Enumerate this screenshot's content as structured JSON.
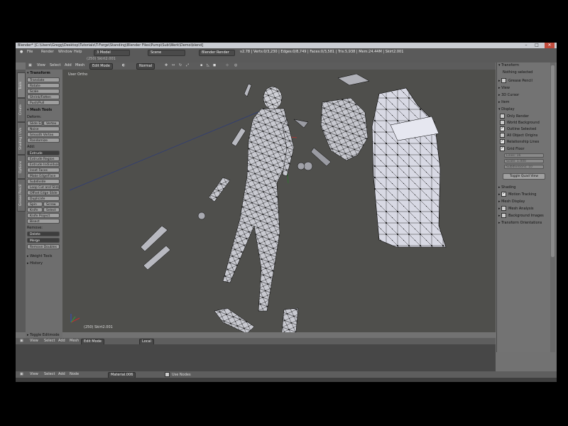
{
  "window": {
    "title": "Blender* [C:\\Users\\Gregg\\Desktop\\Tutorials\\T-Forge\\Standing\\Blender Files\\Pump\\Sub\\Werk\\Demo\\blend]",
    "minimize": "–",
    "maximize": "□",
    "close": "✕"
  },
  "info_header": {
    "menus": [
      "File",
      "Render",
      "Window",
      "Help"
    ],
    "layout": "3 Model",
    "scene": "Scene",
    "engine": "Blender Render",
    "stats": "v2.78 | Verts:0/3,230 | Edges:0/8,749 | Faces:0/3,581 | Tris:5,938 | Mem:24.44M | Skirt2.001",
    "subline": "(250) Skirt2.001"
  },
  "view3d_header": {
    "menus": [
      "View",
      "Select",
      "Add",
      "Mesh"
    ],
    "mode": "Edit Mode",
    "shading": "Normal"
  },
  "toolshelf": {
    "tabs": [
      "Tools",
      "Create",
      "Shading / UVs",
      "Options",
      "Grease Pencil"
    ],
    "transform_header": "Transform",
    "transform_buttons": [
      "Translate",
      "Rotate",
      "Scale",
      "Shrink/Fatten",
      "Push/Pull"
    ],
    "mesh_tools_header": "Mesh Tools",
    "deform_label": "Deform:",
    "slide_edge": "Slide Edge",
    "vertex": "Vertex",
    "noise": "Noise",
    "smooth_vertex": "Smooth Vertex",
    "randomize": "Randomize",
    "add_label": "Add:",
    "extrude": "Extrude",
    "add_buttons": [
      "Extrude Region",
      "Extrude Individual",
      "Inset Faces",
      "Make Edge/Face",
      "Subdivide",
      "Loop Cut and Slide",
      "Offset Edge Slide",
      "Duplicate"
    ],
    "spin": "Spin",
    "screw": "Screw",
    "knife": "Knife",
    "select": "Select",
    "knife_project": "Knife Project",
    "bisect": "Bisect",
    "remove_label": "Remove:",
    "delete": "Delete",
    "merge": "Merge",
    "remove_doubles": "Remove Doubles",
    "weight_tools": "Weight Tools",
    "history": "History",
    "toggle_editmode": "Toggle Editmode"
  },
  "viewport": {
    "view_label": "User Ortho",
    "object_label": "(250) Skirt2.001"
  },
  "properties": {
    "transform": "Transform",
    "nothing_selected": "Nothing selected",
    "grease_pencil": "Grease Pencil",
    "view": "View",
    "cursor": "3D Cursor",
    "item": "Item",
    "display": "Display",
    "display_checks": [
      {
        "label": "Only Render",
        "checked": false
      },
      {
        "label": "World Background",
        "checked": false
      },
      {
        "label": "Outline Selected",
        "checked": true
      },
      {
        "label": "All Object Origins",
        "checked": false
      },
      {
        "label": "Relationship Lines",
        "checked": true
      }
    ],
    "grid_floor": "Grid Floor",
    "lines": "Lines: 16",
    "scale": "Scale: 1.000",
    "subdivisions": "Subdivisions: 10",
    "toggle_quad_view": "Toggle Quad View",
    "panels": [
      "Shading",
      "Motion Tracking",
      "Mesh Display",
      "Mesh Analysis",
      "Background Images",
      "Transform Orientations"
    ]
  },
  "timeline_header": {
    "menus": [
      "View",
      "Select",
      "Add",
      "Mesh"
    ],
    "mode": "Edit Mode",
    "orientation": "Local"
  },
  "node_header": {
    "menus": [
      "View",
      "Select",
      "Add",
      "Node"
    ],
    "material": "Material.006",
    "use_nodes": "Use Nodes"
  }
}
